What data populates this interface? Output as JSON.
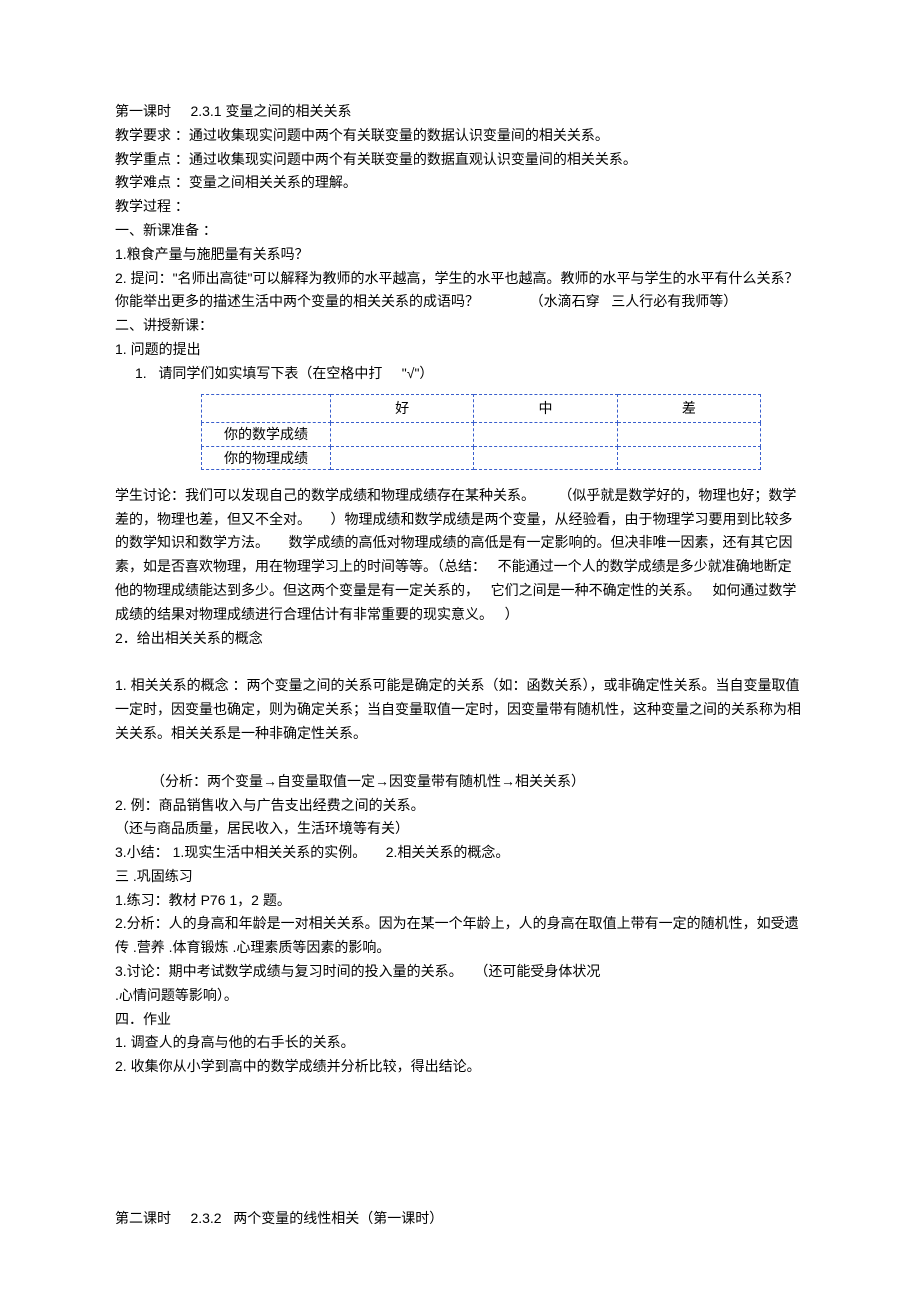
{
  "lesson1_header": "第一课时     2.3.1  变量之间的相关关系",
  "req_line": "教学要求 ：通过收集现实问题中两个有关联变量的数据认识变量间的相关关系。",
  "focus_line": "教学重点 ：通过收集现实问题中两个有关联变量的数据直观认识变量间的相关关系。",
  "diff_line": "教学难点 ：变量之间相关关系的理解。",
  "proc_line": "教学过程 ：",
  "prep_heading": "一、新课准备 ：",
  "prep_q1": "1.粮食产量与施肥量有关系吗？",
  "prep_q2a": "2. 提问：\"名师出高徒\"可以解释为教师的水平越高，学生的水平也越高。教师的水平与学生的水平有什么关系？你能举出更多的描述生活中两个变量的相关关系的成语吗？             （水滴石穿   三人行必有我师等）",
  "teach_heading": "二、讲授新课：",
  "topic1_heading": "1. 问题的提出",
  "topic1_item1": "1.   请同学们如实填写下表（在空格中打     \"√\"）",
  "table": {
    "headers": [
      "",
      "好",
      "中",
      "差"
    ],
    "row1": [
      "你的数学成绩",
      "",
      "",
      ""
    ],
    "row2": [
      "你的物理成绩",
      "",
      "",
      ""
    ]
  },
  "discussion": "学生讨论：我们可以发现自己的数学成绩和物理成绩存在某种关系。      （似乎就是数学好的，物理也好；数学差的，物理也差，但又不全对。     ）物理成绩和数学成绩是两个变量，从经验看，由于物理学习要用到比较多的数学知识和数学方法。     数学成绩的高低对物理成绩的高低是有一定影响的。但决非唯一因素，还有其它因素，如是否喜欢物理，用在物理学习上的时间等等。（总结：   不能通过一个人的数学成绩是多少就准确地断定他的物理成绩能达到多少。但这两个变量是有一定关系的，   它们之间是一种不确定性的关系。   如何通过数学成绩的结果对物理成绩进行合理估计有非常重要的现实意义。   ）",
  "topic2_heading": "2．给出相关关系的概念",
  "concept1": "1. 相关关系的概念  ：两个变量之间的关系可能是确定的关系（如：函数关系），或非确定性关系。当自变量取值一定时，因变量也确定，则为确定关系；当自变量取值一定时，因变量带有随机性，这种变量之间的关系称为相关关系。相关关系是一种非确定性关系。",
  "analysis_line": "（分析：两个变量→自变量取值一定→因变量带有随机性→相关关系）",
  "concept2": "2. 例：商品销售收入与广告支出经费之间的关系。",
  "concept2b": "（还与商品质量，居民收入，生活环境等有关）",
  "concept3": "3.小结：  1.现实生活中相关关系的实例。     2.相关关系的概念。",
  "part3_heading": "三 .巩固练习",
  "ex1": "1.练习：教材  P76   1，2 题。",
  "ex2": "2.分析：人的身高和年龄是一对相关关系。因为在某一个年龄上，人的身高在取值上带有一定的随机性，如受遗传 .营养 .体育锻炼 .心理素质等因素的影响。",
  "ex3": "3.讨论：期中考试数学成绩与复习时间的投入量的关系。   （还可能受身体状况",
  "ex3b": ".心情问题等影响）。",
  "part4_heading": "四．作业",
  "hw1": "1. 调查人的身高与他的右手长的关系。",
  "hw2": "2. 收集你从小学到高中的数学成绩并分析比较，得出结论。",
  "lesson2_header": "第二课时     2.3.2   两个变量的线性相关（第一课时）"
}
